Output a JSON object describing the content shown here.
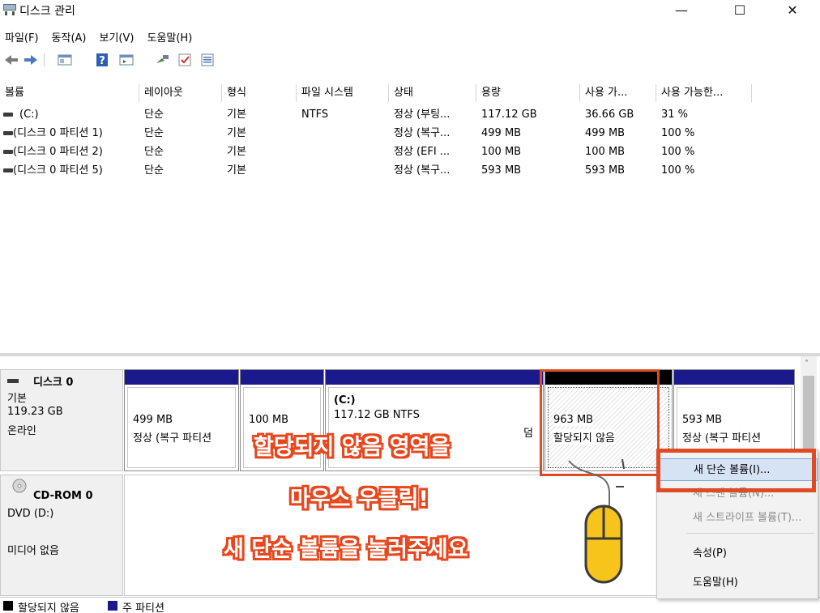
{
  "window": {
    "title": "디스크 관리",
    "minimize_glyph": "—",
    "maximize_glyph": "☐",
    "close_glyph": "✕"
  },
  "menu": [
    "파일(F)",
    "동작(A)",
    "보기(V)",
    "도움말(H)"
  ],
  "toolbar_icons": [
    "back-arrow-icon",
    "forward-arrow-icon",
    "console-tree-icon",
    "help-icon",
    "action-pane-icon",
    "connect-icon",
    "check-icon",
    "properties-icon"
  ],
  "volume_list": {
    "columns": [
      "볼륨",
      "레이아웃",
      "형식",
      "파일 시스템",
      "상태",
      "용량",
      "사용 가...",
      "사용 가능한..."
    ],
    "rows": [
      {
        "volume": "(C:)",
        "layout": "단순",
        "type": "기본",
        "fs": "NTFS",
        "status": "정상 (부팅...",
        "capacity": "117.12 GB",
        "free": "36.66 GB",
        "pct": "31 %"
      },
      {
        "volume": "(디스크 0 파티션 1)",
        "layout": "단순",
        "type": "기본",
        "fs": "",
        "status": "정상 (복구...",
        "capacity": "499 MB",
        "free": "499 MB",
        "pct": "100 %"
      },
      {
        "volume": "(디스크 0 파티션 2)",
        "layout": "단순",
        "type": "기본",
        "fs": "",
        "status": "정상 (EFI ...",
        "capacity": "100 MB",
        "free": "100 MB",
        "pct": "100 %"
      },
      {
        "volume": "(디스크 0 파티션 5)",
        "layout": "단순",
        "type": "기본",
        "fs": "",
        "status": "정상 (복구...",
        "capacity": "593 MB",
        "free": "593 MB",
        "pct": "100 %"
      }
    ]
  },
  "disk0": {
    "name": "디스크 0",
    "type": "기본",
    "size": "119.23 GB",
    "state": "온라인",
    "partitions": [
      {
        "line1": "",
        "line2": "499 MB",
        "line3": "정상 (복구 파티션"
      },
      {
        "line1": "",
        "line2": "100 MB",
        "line3": ""
      },
      {
        "line1": "(C:)",
        "line2": "117.12 GB NTFS",
        "line3": "덤"
      },
      {
        "line1": "",
        "line2": "963 MB",
        "line3": "할당되지 않음"
      },
      {
        "line1": "",
        "line2": "593 MB",
        "line3": "정상 (복구 파티션"
      }
    ]
  },
  "cdrom": {
    "name": "CD-ROM 0",
    "drive": "DVD (D:)",
    "media": "미디어 없음"
  },
  "legend": {
    "unallocated": "할당되지 않음",
    "primary": "주 파티션",
    "unallocated_color": "#000000",
    "primary_color": "#1a1a8c"
  },
  "context_menu": {
    "items": [
      {
        "label": "새 단순 볼륨(I)...",
        "enabled": true
      },
      {
        "label": "새 스팬 볼륨(N)...",
        "enabled": false
      },
      {
        "label": "새 스트라이프 볼륨(T)...",
        "enabled": false
      },
      {
        "label": "속성(P)",
        "enabled": true
      },
      {
        "label": "도움말(H)",
        "enabled": true
      }
    ]
  },
  "annotation": {
    "line1": "할당되지 않음 영역을",
    "line2": "마우스 우클릭!",
    "line3": "새 단순 볼륨을 눌러주세요",
    "accent": "#e8471d"
  }
}
